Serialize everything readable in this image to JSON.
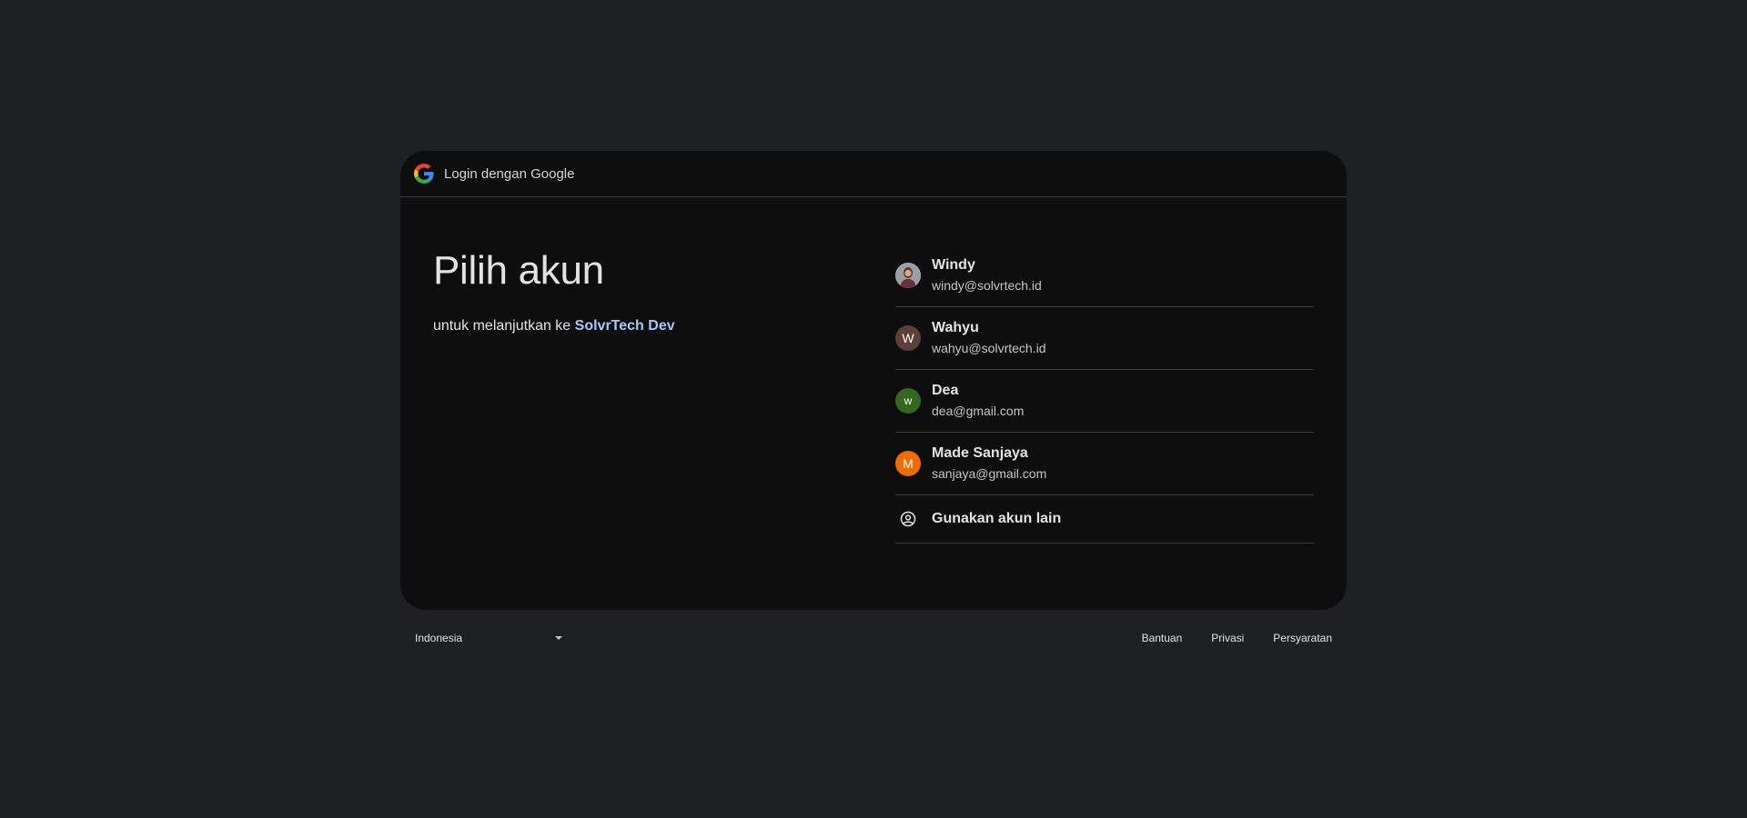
{
  "header": {
    "title": "Login dengan Google"
  },
  "main": {
    "title": "Pilih akun",
    "subtitle_prefix": "untuk melanjutkan ke ",
    "app_name": "SolvrTech Dev"
  },
  "accounts": [
    {
      "name": "Windy",
      "email": "windy@solvrtech.id",
      "avatar_type": "photo",
      "avatar_letter": "",
      "avatar_color": "#8a8f96"
    },
    {
      "name": "Wahyu",
      "email": "wahyu@solvrtech.id",
      "avatar_type": "letter",
      "avatar_letter": "W",
      "avatar_color": "#5d4037"
    },
    {
      "name": "Dea",
      "email": "dea@gmail.com",
      "avatar_type": "letter",
      "avatar_letter": "w",
      "avatar_color": "#33691e"
    },
    {
      "name": "Made Sanjaya",
      "email": "sanjaya@gmail.com",
      "avatar_type": "letter",
      "avatar_letter": "M",
      "avatar_color": "#ef6c00"
    }
  ],
  "use_another": {
    "label": "Gunakan akun lain",
    "icon": "account-circle-icon"
  },
  "footer": {
    "language": "Indonesia",
    "links": [
      "Bantuan",
      "Privasi",
      "Persyaratan"
    ]
  },
  "colors": {
    "page_bg": "#1f2023",
    "card_bg": "#0e0e0e",
    "accent": "#a8c7fa",
    "divider": "#3c3d40"
  }
}
